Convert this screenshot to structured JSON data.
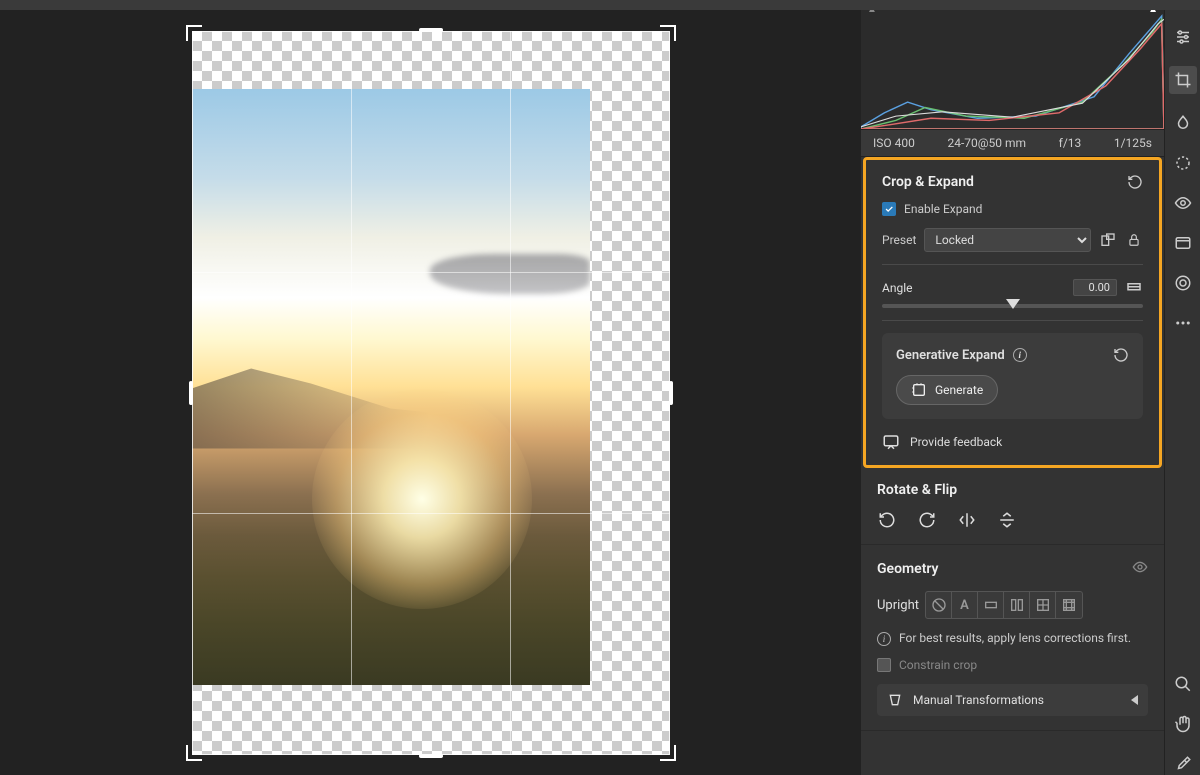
{
  "meta": {
    "iso": "ISO 400",
    "lens": "24-70@50 mm",
    "aperture": "f/13",
    "shutter": "1/125s"
  },
  "crop": {
    "title": "Crop & Expand",
    "enable_expand": "Enable Expand",
    "preset_label": "Preset",
    "preset_value": "Locked",
    "angle_label": "Angle",
    "angle_value": "0.00"
  },
  "gen": {
    "title": "Generative Expand",
    "button": "Generate",
    "feedback": "Provide feedback"
  },
  "rotate": {
    "title": "Rotate & Flip"
  },
  "geometry": {
    "title": "Geometry",
    "upright_label": "Upright",
    "hint": "For best results, apply lens corrections first.",
    "constrain": "Constrain crop",
    "manual": "Manual Transformations"
  }
}
